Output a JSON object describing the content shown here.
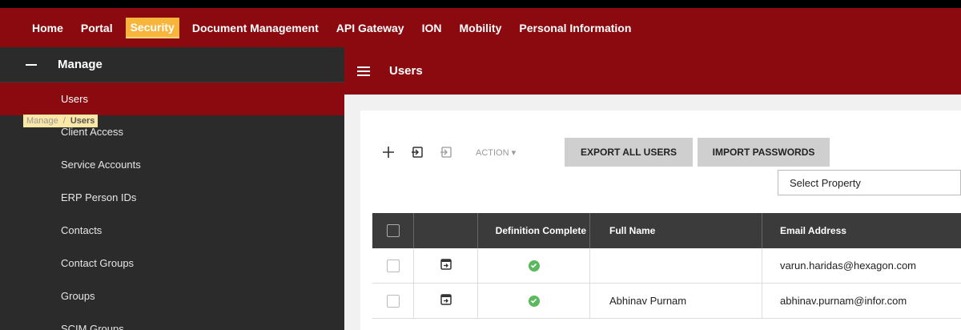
{
  "topnav": {
    "items": [
      {
        "label": "Home"
      },
      {
        "label": "Portal"
      },
      {
        "label": "Security",
        "active": true
      },
      {
        "label": "Document Management"
      },
      {
        "label": "API Gateway"
      },
      {
        "label": "ION"
      },
      {
        "label": "Mobility"
      },
      {
        "label": "Personal Information"
      }
    ]
  },
  "sidebar": {
    "header": "Manage",
    "items": [
      {
        "label": "Users",
        "active": true
      },
      {
        "label": "Client Access"
      },
      {
        "label": "Service Accounts"
      },
      {
        "label": "ERP Person IDs"
      },
      {
        "label": "Contacts"
      },
      {
        "label": "Contact Groups"
      },
      {
        "label": "Groups"
      },
      {
        "label": "SCIM Groups"
      }
    ]
  },
  "subheader": {
    "title": "Users"
  },
  "breadcrumb": {
    "parent": "Manage",
    "separator": "/",
    "current": "Users"
  },
  "toolbar": {
    "action_label": "ACTION",
    "export_label": "EXPORT ALL USERS",
    "import_label": "IMPORT PASSWORDS"
  },
  "select_property": {
    "value": "Select Property"
  },
  "table": {
    "headers": [
      "",
      "",
      "Definition Complete",
      "Full Name",
      "Email Address"
    ],
    "rows": [
      {
        "full_name": "",
        "email": "varun.haridas@hexagon.com",
        "complete": true
      },
      {
        "full_name": "Abhinav Purnam",
        "email": "abhinav.purnam@infor.com",
        "complete": true
      }
    ]
  },
  "colors": {
    "brand": "#8b0a0f",
    "highlight": "#f7b53b",
    "sidebar": "#2b2b2b",
    "success": "#5cb85c"
  }
}
